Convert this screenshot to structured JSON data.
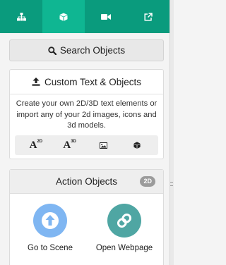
{
  "tabs": [
    {
      "icon": "sitemap-icon",
      "active": false
    },
    {
      "icon": "cube-icon",
      "active": true
    },
    {
      "icon": "video-camera-icon",
      "active": false
    },
    {
      "icon": "external-link-icon",
      "active": false
    }
  ],
  "search": {
    "label": "Search Objects",
    "icon": "search-icon"
  },
  "custom": {
    "title": "Custom Text & Objects",
    "icon": "upload-icon",
    "description": "Create your own 2D/3D text elements or import any of your 2d images, icons and 3d models.",
    "tools": [
      {
        "letter": "A",
        "sup": "2D",
        "icon": "text-2d-icon"
      },
      {
        "letter": "A",
        "sup": "3D",
        "icon": "text-3d-icon"
      },
      {
        "icon": "image-icon"
      },
      {
        "icon": "cube-icon"
      }
    ]
  },
  "action": {
    "title": "Action Objects",
    "badge": "2D",
    "items": [
      {
        "label": "Go to Scene",
        "icon": "arrow-up-icon",
        "color": "#7fb6f2"
      },
      {
        "label": "Open Webpage",
        "icon": "link-icon",
        "color": "#4fa6a3"
      }
    ]
  },
  "colors": {
    "tabbar": "#0a9b7d",
    "tab_active": "#0fb692"
  }
}
